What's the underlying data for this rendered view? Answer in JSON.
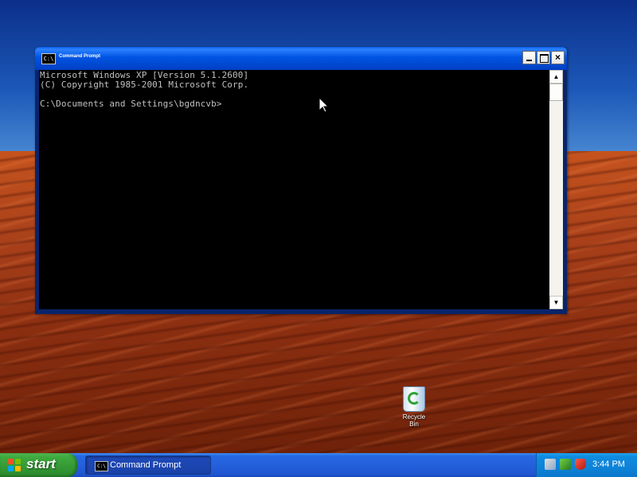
{
  "desktop": {
    "icons": [
      {
        "name": "Recycle Bin",
        "label": "Recycle Bin"
      }
    ]
  },
  "window": {
    "title": "Command Prompt",
    "icon_text": "C:\\",
    "buttons": {
      "minimize": "minimize",
      "maximize": "maximize",
      "close": "×"
    },
    "console": {
      "lines": [
        "Microsoft Windows XP [Version 5.1.2600]",
        "(C) Copyright 1985-2001 Microsoft Corp.",
        "",
        "C:\\Documents and Settings\\bgdncvb>"
      ]
    },
    "scrollbar": {
      "up_arrow": "▲",
      "down_arrow": "▼"
    }
  },
  "taskbar": {
    "start_label": "start",
    "tasks": [
      {
        "label": "Command Prompt",
        "icon_text": "C:\\"
      }
    ],
    "tray": {
      "icons": [
        "network-icon",
        "safely-remove-icon",
        "security-shield-icon"
      ],
      "clock": "3:44 PM"
    }
  },
  "colors": {
    "console_bg": "#000000",
    "console_text": "#c0c0c0",
    "titlebar": "#0054e3",
    "taskbar": "#245edb",
    "start_button": "#3c9d3c",
    "tray": "#0f8be0"
  }
}
